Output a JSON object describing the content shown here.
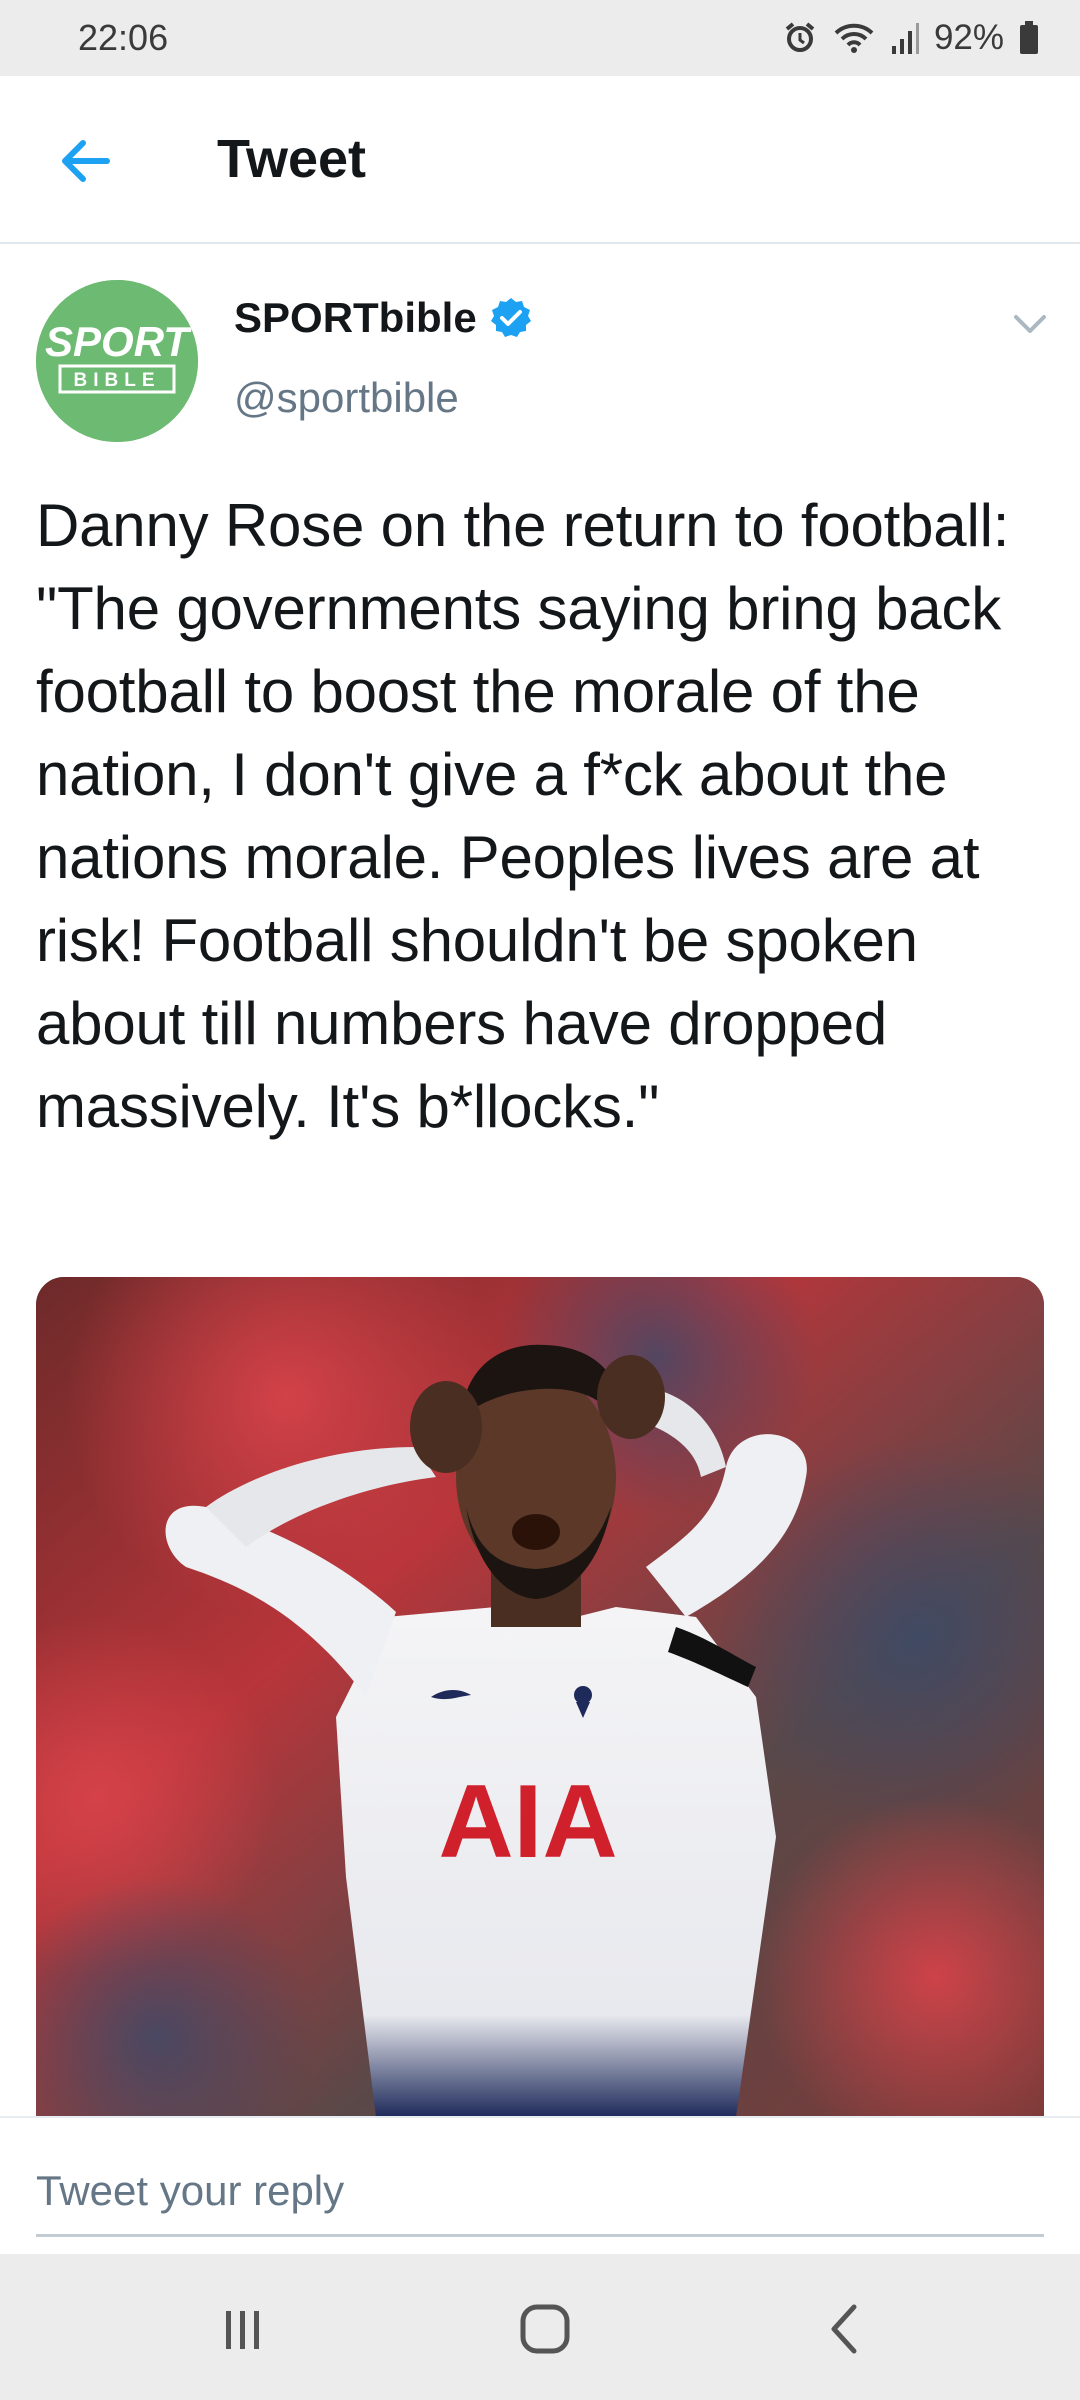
{
  "status_bar": {
    "time": "22:06",
    "battery": "92%",
    "icons": [
      "alarm-icon",
      "wifi-icon",
      "signal-icon",
      "battery-icon"
    ]
  },
  "header": {
    "back_icon": "back-arrow-icon",
    "title": "Tweet"
  },
  "tweet": {
    "author": {
      "name": "SPORTbible",
      "handle": "@sportbible",
      "verified": true,
      "avatar_text_top": "SPORT",
      "avatar_text_bottom": "BIBLE"
    },
    "text": "Danny Rose on the return to football: \"The governments saying bring back football to boost the morale of the nation, I don't give a f*ck about the nations morale. Peoples lives are at risk! Football shouldn't be spoken about till numbers have dropped massively. It's b*llocks.\"",
    "media": {
      "shirt_sponsor": "AIA"
    }
  },
  "reply": {
    "placeholder": "Tweet your reply"
  },
  "nav": {
    "icons": [
      "recent-apps-icon",
      "home-icon",
      "back-icon"
    ]
  },
  "colors": {
    "accent": "#1da1f2",
    "text": "#14171a",
    "secondary": "#657786",
    "avatar_bg": "#6dba72"
  }
}
